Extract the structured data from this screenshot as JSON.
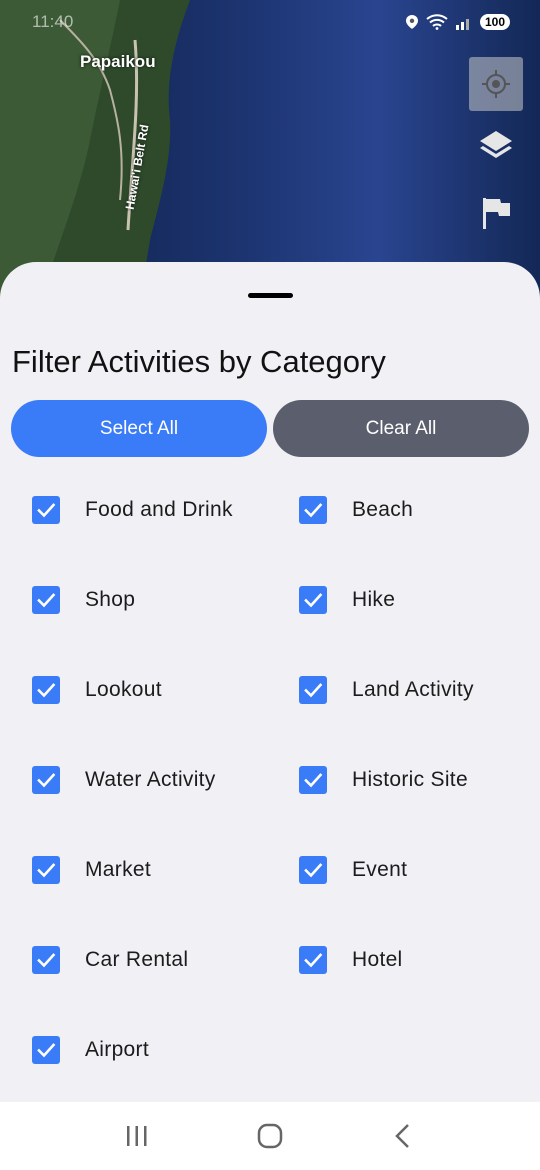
{
  "status_bar": {
    "time": "11:40",
    "battery": "100"
  },
  "map": {
    "place_label": "Papaikou",
    "road_label": "Hawai'i Belt Rd"
  },
  "map_controls": {
    "locate_icon": "my-location-icon",
    "layers_icon": "layers-icon",
    "flag_icon": "flag-icon"
  },
  "sheet": {
    "title": "Filter Activities by Category",
    "select_all_label": "Select All",
    "clear_all_label": "Clear All",
    "categories": [
      {
        "label": "Food and Drink",
        "checked": true
      },
      {
        "label": "Beach",
        "checked": true
      },
      {
        "label": "Shop",
        "checked": true
      },
      {
        "label": "Hike",
        "checked": true
      },
      {
        "label": "Lookout",
        "checked": true
      },
      {
        "label": "Land Activity",
        "checked": true
      },
      {
        "label": "Water Activity",
        "checked": true
      },
      {
        "label": "Historic Site",
        "checked": true
      },
      {
        "label": "Market",
        "checked": true
      },
      {
        "label": "Event",
        "checked": true
      },
      {
        "label": "Car Rental",
        "checked": true
      },
      {
        "label": "Hotel",
        "checked": true
      },
      {
        "label": "Airport",
        "checked": true
      }
    ]
  },
  "colors": {
    "accent": "#3a7bf7",
    "clear_button": "#5b5e6c",
    "sheet_background": "#f1f0f5"
  }
}
